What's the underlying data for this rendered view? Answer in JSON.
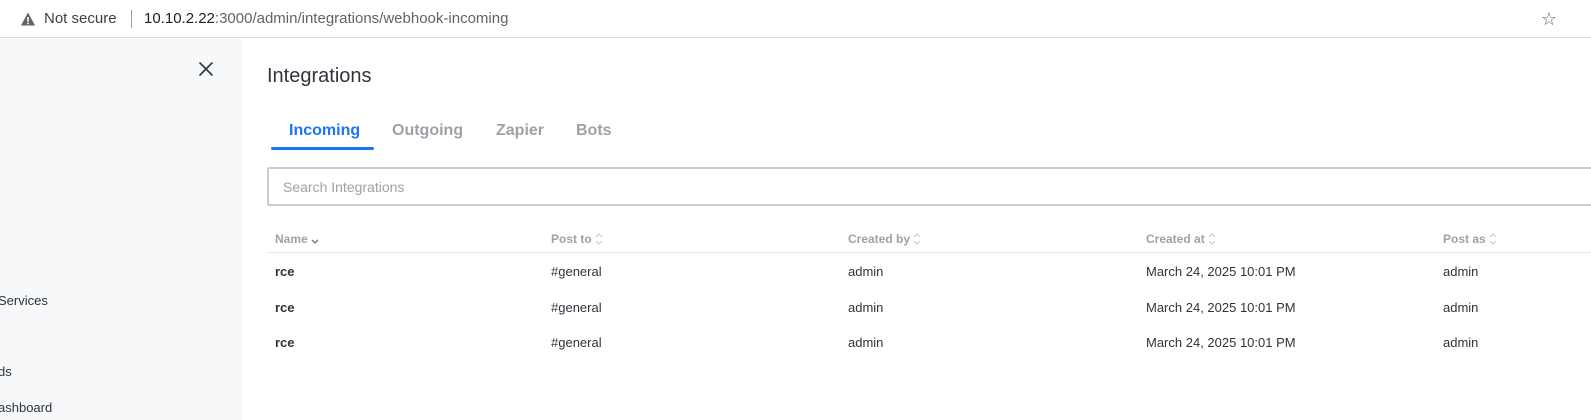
{
  "browser": {
    "security_label": "Not secure",
    "url_host": "10.10.2.22",
    "url_rest": ":3000/admin/integrations/webhook-incoming"
  },
  "sidebar": {
    "items": [
      {
        "label": "Services"
      },
      {
        "label": "ds"
      },
      {
        "label": "ashboard"
      }
    ]
  },
  "page": {
    "title": "Integrations"
  },
  "tabs": [
    {
      "label": "Incoming",
      "active": true
    },
    {
      "label": "Outgoing",
      "active": false
    },
    {
      "label": "Zapier",
      "active": false
    },
    {
      "label": "Bots",
      "active": false
    }
  ],
  "search": {
    "placeholder": "Search Integrations",
    "value": ""
  },
  "table": {
    "columns": [
      "Name",
      "Post to",
      "Created by",
      "Created at",
      "Post as"
    ],
    "rows": [
      {
        "name": "rce",
        "post_to": "#general",
        "created_by": "admin",
        "created_at": "March 24, 2025 10:01 PM",
        "post_as": "admin"
      },
      {
        "name": "rce",
        "post_to": "#general",
        "created_by": "admin",
        "created_at": "March 24, 2025 10:01 PM",
        "post_as": "admin"
      },
      {
        "name": "rce",
        "post_to": "#general",
        "created_by": "admin",
        "created_at": "March 24, 2025 10:01 PM",
        "post_as": "admin"
      }
    ]
  },
  "colors": {
    "accent": "#1d74f5",
    "muted_text": "#9ea2a8",
    "primary_text": "#2f343d",
    "sidebar_bg": "#f7f8fa"
  },
  "icons": {
    "security": "warning-triangle-icon",
    "bookmark": "star-icon",
    "close": "close-icon",
    "sort": "sort-icon"
  }
}
